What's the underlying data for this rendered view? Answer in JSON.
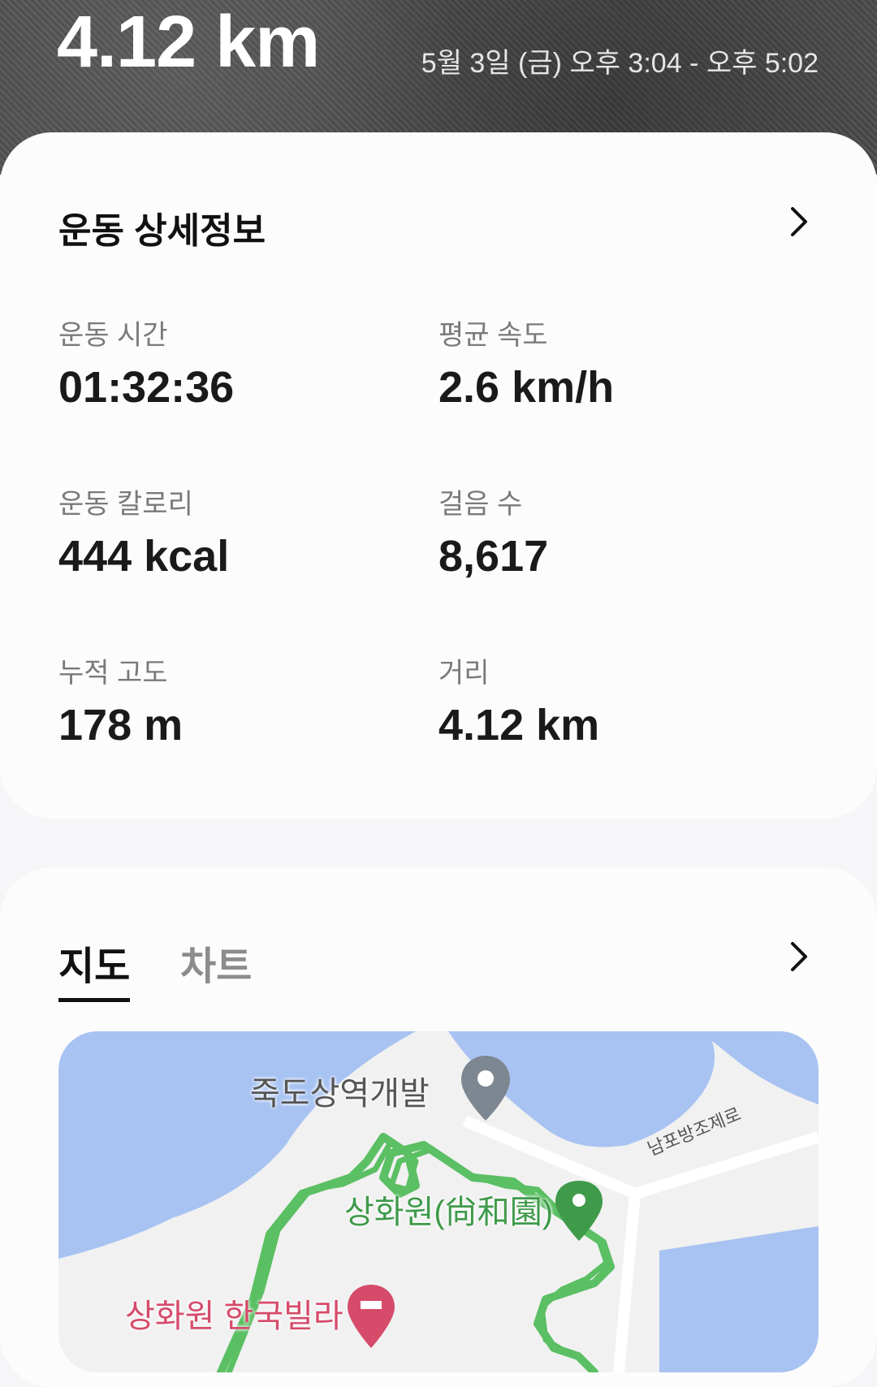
{
  "header": {
    "distance": "4.12 km",
    "date_range": "5월 3일 (금) 오후 3:04 - 오후 5:02"
  },
  "details": {
    "title": "운동 상세정보",
    "stats": [
      {
        "label": "운동 시간",
        "value": "01:32:36"
      },
      {
        "label": "평균 속도",
        "value": "2.6 km/h"
      },
      {
        "label": "운동 칼로리",
        "value": "444 kcal"
      },
      {
        "label": "걸음 수",
        "value": "8,617"
      },
      {
        "label": "누적 고도",
        "value": "178 m"
      },
      {
        "label": "거리",
        "value": "4.12 km"
      }
    ]
  },
  "map_section": {
    "tabs": [
      {
        "label": "지도",
        "active": true
      },
      {
        "label": "차트",
        "active": false
      }
    ],
    "map_labels": {
      "place1": "죽도상역개발",
      "place2": "상화원(尙和園)",
      "place3": "상화원 한국빌라",
      "road": "남포방조제로"
    }
  },
  "colors": {
    "accent_green": "#5bbf63",
    "water": "#a8c3f2",
    "land": "#f1f1f1",
    "place_green": "#3f9a4a",
    "place_red": "#d64b6a"
  },
  "icons": [
    "chevron-right-icon",
    "location-pin-icon",
    "park-pin-icon",
    "hotel-pin-icon"
  ]
}
